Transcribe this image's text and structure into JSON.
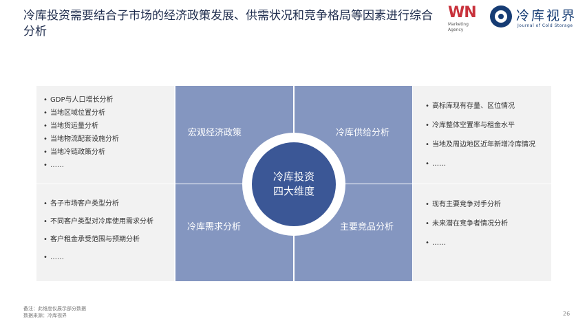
{
  "title": "冷库投资需要结合子市场的经济政策发展、供需状况和竞争格局等因素进行综合分析",
  "logos": {
    "wn_mark": "WN",
    "wn_sub": "Marketing Agency",
    "cs_name": "冷库视界",
    "cs_en": "Journal of Cold Storage"
  },
  "center": {
    "line1": "冷库投资",
    "line2": "四大维度"
  },
  "quadrants": {
    "top_left": "宏观经济政策",
    "top_right": "冷库供给分析",
    "bottom_left": "冷库需求分析",
    "bottom_right": "主要竞品分析"
  },
  "panels": {
    "top_left": [
      "GDP与人口增长分析",
      "当地区域位置分析",
      "当地货运量分析",
      "当地物流配套设施分析",
      "当地冷链政策分析",
      "……"
    ],
    "bottom_left": [
      "各子市场客户类型分析",
      "不同客户类型对冷库使用需求分析",
      "客户租金承受范围与预期分析",
      "……"
    ],
    "top_right": [
      "高标库现有存量、区位情况",
      "冷库整体空置率与租金水平",
      "当地及周边地区近年新增冷库情况",
      "……"
    ],
    "bottom_right": [
      "现有主要竞争对手分析",
      "未来潜在竞争者情况分析",
      "……"
    ]
  },
  "notes": {
    "line1": "备注：此维度仅展示部分数据",
    "line2": "数据来源：冷库视界"
  },
  "page_number": "26",
  "colors": {
    "quadrant": "#8496c0",
    "core": "#3b5796",
    "panel": "#f2f2f2",
    "title": "#1f2d4e"
  }
}
